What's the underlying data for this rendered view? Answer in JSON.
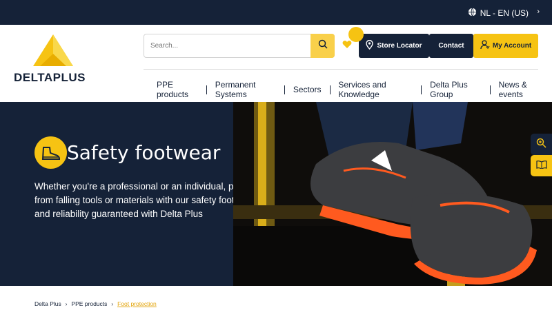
{
  "topbar": {
    "language_label": "NL - EN (US)",
    "globe_icon": "globe-icon",
    "chevron_icon": "chevron-right-icon"
  },
  "brand": {
    "logo_text": "DELTAPLUS",
    "logo_color": "#f6c313",
    "navy": "#152238"
  },
  "search": {
    "placeholder": "Search...",
    "icon": "search-icon"
  },
  "actions": {
    "wishlist_icon": "heart-icon",
    "store_locator_label": "Store Locator",
    "contact_label": "Contact",
    "account_label": "My Account"
  },
  "nav": {
    "items": [
      {
        "label": "PPE products"
      },
      {
        "label": "Permanent Systems"
      },
      {
        "label": "Sectors"
      },
      {
        "label": "Services and Knowledge"
      },
      {
        "label": "Delta Plus Group"
      },
      {
        "label": "News & events"
      }
    ]
  },
  "hero": {
    "title": "Safety footwear",
    "icon": "boot-icon",
    "text_lines": [
      "Whether you're a professional or an individual, protect",
      "from falling tools or materials with our safety footwear",
      "and reliability guaranteed with Delta Plus"
    ]
  },
  "side_tabs": {
    "compare_icon": "zoom-plus-icon",
    "guide_icon": "book-icon"
  },
  "breadcrumb": {
    "items": [
      "Delta Plus",
      "PPE products"
    ],
    "current": "Foot protection"
  }
}
